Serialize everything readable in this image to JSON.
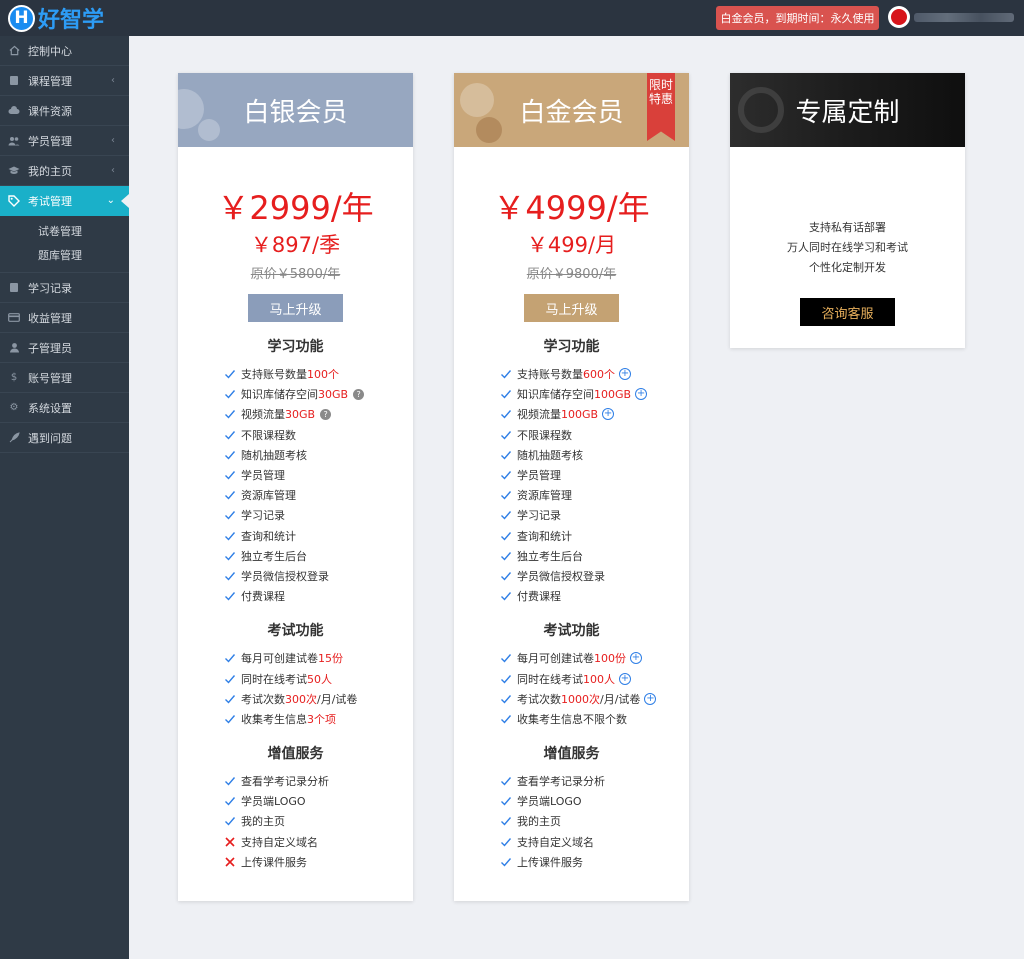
{
  "app": {
    "logo_letter": "H",
    "name": "好智学"
  },
  "header": {
    "vip_status": "白金会员，到期时间：永久使用"
  },
  "sidebar": {
    "items": [
      {
        "label": "控制中心",
        "icon": "home-icon"
      },
      {
        "label": "课程管理",
        "icon": "book-icon"
      },
      {
        "label": "课件资源",
        "icon": "cloud-icon"
      },
      {
        "label": "学员管理",
        "icon": "users-icon"
      },
      {
        "label": "我的主页",
        "icon": "graduation-cap-icon"
      },
      {
        "label": "考试管理",
        "icon": "tag-icon"
      },
      {
        "label": "学习记录",
        "icon": "book-icon"
      },
      {
        "label": "收益管理",
        "icon": "card-icon"
      },
      {
        "label": "子管理员",
        "icon": "user-icon"
      },
      {
        "label": "账号管理",
        "icon": "dollar-icon"
      },
      {
        "label": "系统设置",
        "icon": "gear-icon"
      },
      {
        "label": "遇到问题",
        "icon": "rocket-icon"
      }
    ],
    "sub_items": [
      "试卷管理",
      "题库管理"
    ]
  },
  "plans": {
    "silver": {
      "name": "白银会员",
      "price_year": "￥2999/年",
      "price_quarter": "￥897/季",
      "original": "原价￥5800/年",
      "button": "马上升级",
      "learn_title": "学习功能",
      "learn": [
        {
          "pre": "支持账号数量",
          "hl": "100个",
          "post": "",
          "icon": ""
        },
        {
          "pre": "知识库储存空间 ",
          "hl": "30GB",
          "post": "",
          "icon": "question"
        },
        {
          "pre": "视频流量",
          "hl": "30GB",
          "post": "",
          "icon": "question"
        },
        {
          "pre": "不限课程数",
          "hl": "",
          "post": "",
          "icon": ""
        },
        {
          "pre": "随机抽题考核",
          "hl": "",
          "post": "",
          "icon": ""
        },
        {
          "pre": "学员管理",
          "hl": "",
          "post": "",
          "icon": ""
        },
        {
          "pre": "资源库管理",
          "hl": "",
          "post": "",
          "icon": ""
        },
        {
          "pre": "学习记录",
          "hl": "",
          "post": "",
          "icon": ""
        },
        {
          "pre": "查询和统计",
          "hl": "",
          "post": "",
          "icon": ""
        },
        {
          "pre": "独立考生后台",
          "hl": "",
          "post": "",
          "icon": ""
        },
        {
          "pre": "学员微信授权登录",
          "hl": "",
          "post": "",
          "icon": ""
        },
        {
          "pre": "付费课程",
          "hl": "",
          "post": "",
          "icon": ""
        }
      ],
      "exam_title": "考试功能",
      "exam": [
        {
          "pre": "每月可创建试卷",
          "hl": "15份",
          "post": "",
          "icon": ""
        },
        {
          "pre": "同时在线考试",
          "hl": "50人",
          "post": "",
          "icon": ""
        },
        {
          "pre": "考试次数",
          "hl": "300次",
          "post": "/月/试卷",
          "icon": ""
        },
        {
          "pre": "收集考生信息",
          "hl": "3个项",
          "post": "",
          "icon": ""
        }
      ],
      "value_title": "增值服务",
      "value": [
        {
          "pre": "查看学考记录分析",
          "mark": "check"
        },
        {
          "pre": "学员端LOGO",
          "mark": "check"
        },
        {
          "pre": "我的主页",
          "mark": "check"
        },
        {
          "pre": "支持自定义域名",
          "mark": "cross"
        },
        {
          "pre": "上传课件服务",
          "mark": "cross"
        }
      ]
    },
    "gold": {
      "name": "白金会员",
      "ribbon": "限时特惠",
      "price_year": "￥4999/年",
      "price_month": "￥499/月",
      "original": "原价￥9800/年",
      "button": "马上升级",
      "learn_title": "学习功能",
      "learn": [
        {
          "pre": "支持账号数量",
          "hl": "600个",
          "post": "",
          "icon": "plus"
        },
        {
          "pre": "知识库储存空间 ",
          "hl": "100GB",
          "post": "",
          "icon": "plus"
        },
        {
          "pre": "视频流量",
          "hl": "100GB",
          "post": "",
          "icon": "plus"
        },
        {
          "pre": "不限课程数",
          "hl": "",
          "post": "",
          "icon": ""
        },
        {
          "pre": "随机抽题考核",
          "hl": "",
          "post": "",
          "icon": ""
        },
        {
          "pre": "学员管理",
          "hl": "",
          "post": "",
          "icon": ""
        },
        {
          "pre": "资源库管理",
          "hl": "",
          "post": "",
          "icon": ""
        },
        {
          "pre": "学习记录",
          "hl": "",
          "post": "",
          "icon": ""
        },
        {
          "pre": "查询和统计",
          "hl": "",
          "post": "",
          "icon": ""
        },
        {
          "pre": "独立考生后台",
          "hl": "",
          "post": "",
          "icon": ""
        },
        {
          "pre": "学员微信授权登录",
          "hl": "",
          "post": "",
          "icon": ""
        },
        {
          "pre": "付费课程",
          "hl": "",
          "post": "",
          "icon": ""
        }
      ],
      "exam_title": "考试功能",
      "exam": [
        {
          "pre": "每月可创建试卷",
          "hl": "100份",
          "post": "",
          "icon": "plus"
        },
        {
          "pre": "同时在线考试",
          "hl": "100人",
          "post": "",
          "icon": "plus"
        },
        {
          "pre": "考试次数",
          "hl": "1000次",
          "post": "/月/试卷",
          "icon": "plus"
        },
        {
          "pre": "收集考生信息不限个数",
          "hl": "",
          "post": "",
          "icon": ""
        }
      ],
      "value_title": "增值服务",
      "value": [
        {
          "pre": "查看学考记录分析",
          "mark": "check"
        },
        {
          "pre": "学员端LOGO",
          "mark": "check"
        },
        {
          "pre": "我的主页",
          "mark": "check"
        },
        {
          "pre": "支持自定义域名",
          "mark": "check"
        },
        {
          "pre": "上传课件服务",
          "mark": "check"
        }
      ]
    },
    "custom": {
      "name": "专属定制",
      "lines": [
        "支持私有话部署",
        "万人同时在线学习和考试",
        "个性化定制开发"
      ],
      "button": "咨询客服"
    }
  },
  "colors": {
    "accent": "#1ab0c9",
    "price": "#e61e1e",
    "check": "#2f7fe6",
    "cross": "#e61e1e"
  }
}
